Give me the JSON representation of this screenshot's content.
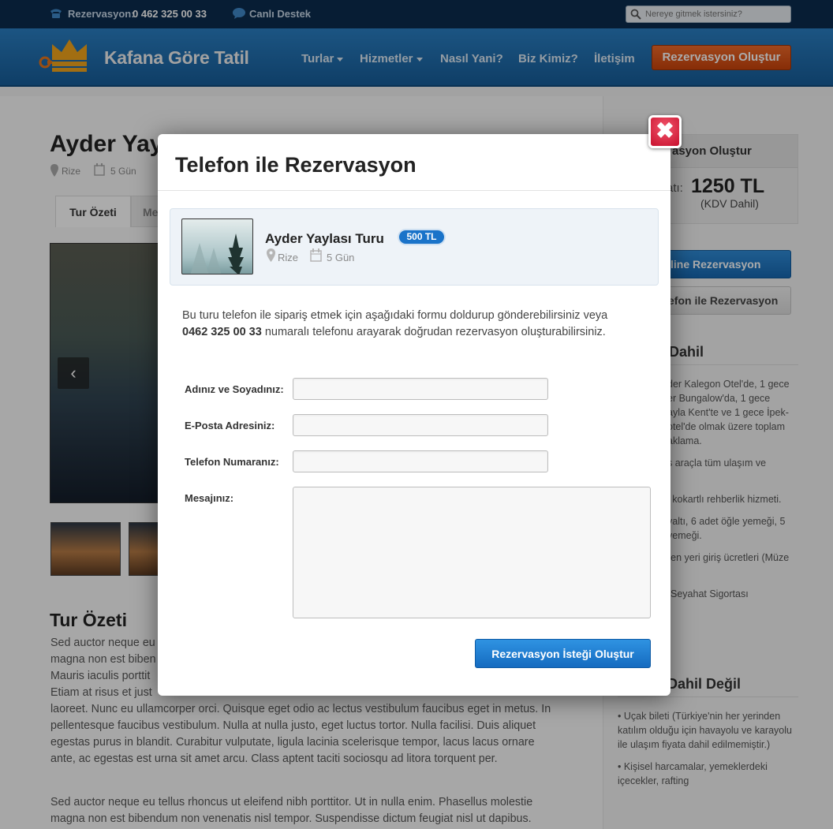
{
  "topbar": {
    "reservation_label": "Rezervasyon:",
    "reservation_phone": "0 462 325 00 33",
    "live_support": "Canlı Destek",
    "search_placeholder": "Nereye gitmek istersiniz?"
  },
  "header": {
    "brand": "Kafana Göre Tatil",
    "nav": [
      "Turlar",
      "Hizmetler",
      "Nasıl Yani?",
      "Biz Kimiz?",
      "İletişim"
    ],
    "cta": "Rezervasyon Oluştur"
  },
  "background": {
    "tour_title": "Ayder Yay",
    "location": "Rize",
    "duration": "5 Gün",
    "tabs": [
      "Tur Özeti",
      "Me"
    ],
    "summary_heading": "Tur Özeti",
    "paragraph1": [
      "Sed auctor neque eu",
      "magna non est biben",
      "Mauris iaculis porttit",
      "Etiam at risus et just",
      "laoreet. Nunc eu ullamcorper orci. Quisque eget odio ac lectus vestibulum faucibus eget in metus. In",
      "pellentesque faucibus vestibulum. Nulla at nulla justo, eget luctus tortor. Nulla facilisi. Duis aliquet",
      "egestas purus in blandit. Curabitur vulputate, ligula lacinia scelerisque tempor, lacus lacus ornare",
      "ante, ac egestas est urna sit amet arcu. Class aptent taciti sociosqu ad litora torquent per."
    ],
    "paragraph2": [
      "Sed auctor neque eu tellus rhoncus ut eleifend nibh porttitor. Ut in nulla enim. Phasellus molestie",
      "magna non est bibendum non venenatis nisl tempor. Suspendisse dictum feugiat nisl ut dapibus."
    ]
  },
  "sidebar": {
    "box_header": "asyon Oluştur",
    "price_label": "atı:",
    "price": "1250 TL",
    "price_note": "(KDV Dahil)",
    "online_button": "line Rezervasyon",
    "phone_button": "efon ile Rezervasyon",
    "included_heading": "Dahil",
    "included_lines": [
      "der Kalegon Otel'de, 1 gece",
      "er Bungalow'da, 1 gece",
      "ayla Kent'te ve 1 gece İpek-",
      "otel'de olmak üzere toplam",
      "aklama.",
      "s araçla tüm ulaşım ve",
      "l kokartlı rehberlik hizmeti.",
      "valtı, 6 adet öğle yemeği, 5",
      "yemeği.",
      "ren yeri giriş ücretleri (Müze",
      "Seyahat Sigortası"
    ],
    "not_included_heading": "Dahil Değil",
    "not_included_lines": [
      "• Uçak bileti (Türkiye'nin her yerinden",
      "katılım olduğu için havayolu ve karayolu",
      "ile ulaşım fiyata dahil edilmemiştir.)",
      "• Kişisel harcamalar, yemeklerdeki",
      "içecekler, rafting"
    ]
  },
  "modal": {
    "title": "Telefon ile Rezervasyon",
    "close_icon": "close-icon",
    "tour": {
      "name": "Ayder Yaylası Turu",
      "price": "500 TL",
      "location": "Rize",
      "duration": "5 Gün"
    },
    "intro_text": "Bu turu telefon ile sipariş etmek için aşağıdaki formu doldurup gönderebilirsiniz veya",
    "intro_phone": "0462 325 00 33",
    "intro_rest": "numaralı telefonu arayarak doğrudan rezervasyon oluşturabilirsiniz.",
    "fields": {
      "name_label": "Adınız ve Soyadınız:",
      "email_label": "E-Posta Adresiniz:",
      "phone_label": "Telefon Numaranız:",
      "message_label": "Mesajınız:",
      "name_value": "",
      "email_value": "",
      "phone_value": "",
      "message_value": ""
    },
    "submit": "Rezervasyon İsteği Oluştur"
  },
  "colors": {
    "topbar": "#0b2c4e",
    "header": "#1d6dae",
    "cta_orange": "#d9561a",
    "primary_blue": "#1a73c9",
    "close_red": "#c8102e"
  }
}
